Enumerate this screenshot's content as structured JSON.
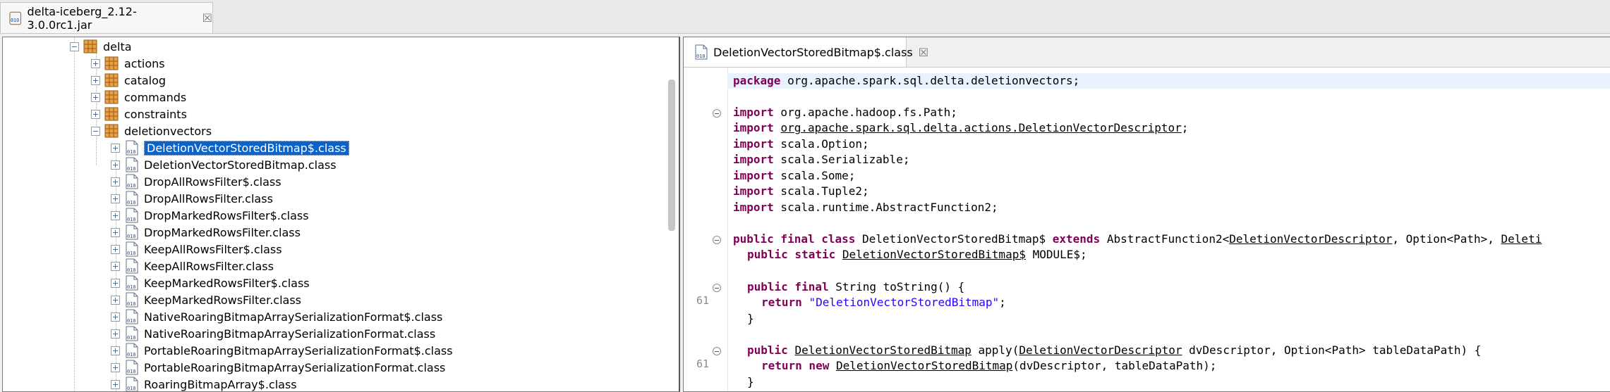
{
  "outer_tab": {
    "title": "delta-iceberg_2.12-3.0.0rc1.jar",
    "close": "☒"
  },
  "tree": {
    "root": "delta",
    "packages": [
      "actions",
      "catalog",
      "commands",
      "constraints",
      "deletionvectors"
    ],
    "classes": [
      "DeletionVectorStoredBitmap$.class",
      "DeletionVectorStoredBitmap.class",
      "DropAllRowsFilter$.class",
      "DropAllRowsFilter.class",
      "DropMarkedRowsFilter$.class",
      "DropMarkedRowsFilter.class",
      "KeepAllRowsFilter$.class",
      "KeepAllRowsFilter.class",
      "KeepMarkedRowsFilter$.class",
      "KeepMarkedRowsFilter.class",
      "NativeRoaringBitmapArraySerializationFormat$.class",
      "NativeRoaringBitmapArraySerializationFormat.class",
      "PortableRoaringBitmapArraySerializationFormat$.class",
      "PortableRoaringBitmapArraySerializationFormat.class",
      "RoaringBitmapArray$.class"
    ]
  },
  "editor": {
    "tab_title": "DeletionVectorStoredBitmap$.class",
    "tab_close": "☒",
    "line_numbers": [
      "61",
      "61"
    ],
    "code": {
      "l1_kw": "package",
      "l1_rest": " org.apache.spark.sql.delta.deletionvectors;",
      "import_kw": "import",
      "imp1": " org.apache.hadoop.fs.Path;",
      "imp2": "org.apache.spark.sql.delta.actions.DeletionVectorDescriptor",
      "imp3": " scala.Option;",
      "imp4": " scala.Serializable;",
      "imp5": " scala.Some;",
      "imp6": " scala.Tuple2;",
      "imp7": " scala.runtime.AbstractFunction2;",
      "cls_kw": "public final class",
      "cls_name": " DeletionVectorStoredBitmap$ ",
      "extends_kw": "extends",
      "cls_ext": " AbstractFunction2<",
      "cls_t1": "DeletionVectorDescriptor",
      "cls_t2": ", Option<Path>, ",
      "cls_t3": "Deleti",
      "mod_kw": "public static",
      "mod_type": "DeletionVectorStoredBitmap$",
      "mod_rest": " MODULE$;",
      "ts_kw": "public final",
      "ts_rest": " String toString() {",
      "ret_kw": "return",
      "ts_str": "\"DeletionVectorStoredBitmap\"",
      "brace": "}",
      "ap_kw": "public",
      "ap_type": "DeletionVectorStoredBitmap",
      "ap_mid": " apply(",
      "ap_p1": "DeletionVectorDescriptor",
      "ap_rest": " dvDescriptor, Option<Path> tableDataPath) {",
      "new_kw": "return new",
      "new_type": "DeletionVectorStoredBitmap",
      "new_rest": "(dvDescriptor, tableDataPath);"
    }
  }
}
